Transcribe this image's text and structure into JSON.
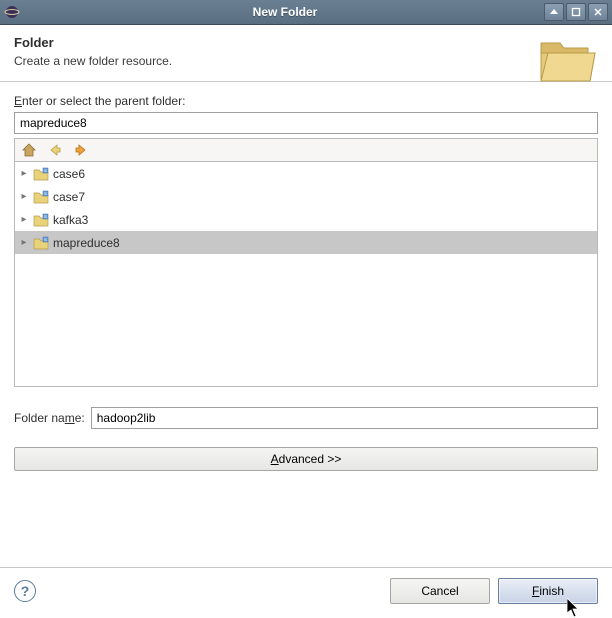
{
  "window": {
    "title": "New Folder"
  },
  "header": {
    "title": "Folder",
    "subtitle": "Create a new folder resource."
  },
  "parentFolder": {
    "labelPre": "E",
    "labelPost": "nter or select the parent folder:",
    "value": "mapreduce8"
  },
  "tree": {
    "items": [
      {
        "label": "case6",
        "selected": false
      },
      {
        "label": "case7",
        "selected": false
      },
      {
        "label": "kafka3",
        "selected": false
      },
      {
        "label": "mapreduce8",
        "selected": true
      }
    ]
  },
  "folderName": {
    "labelPre": "Folder na",
    "labelMid": "m",
    "labelPost": "e:",
    "value": "hadoop2lib"
  },
  "advanced": {
    "labelPre": "A",
    "labelPost": "dvanced >>"
  },
  "buttons": {
    "help": "?",
    "cancel": "Cancel",
    "finishPre": "F",
    "finishPost": "inish"
  }
}
